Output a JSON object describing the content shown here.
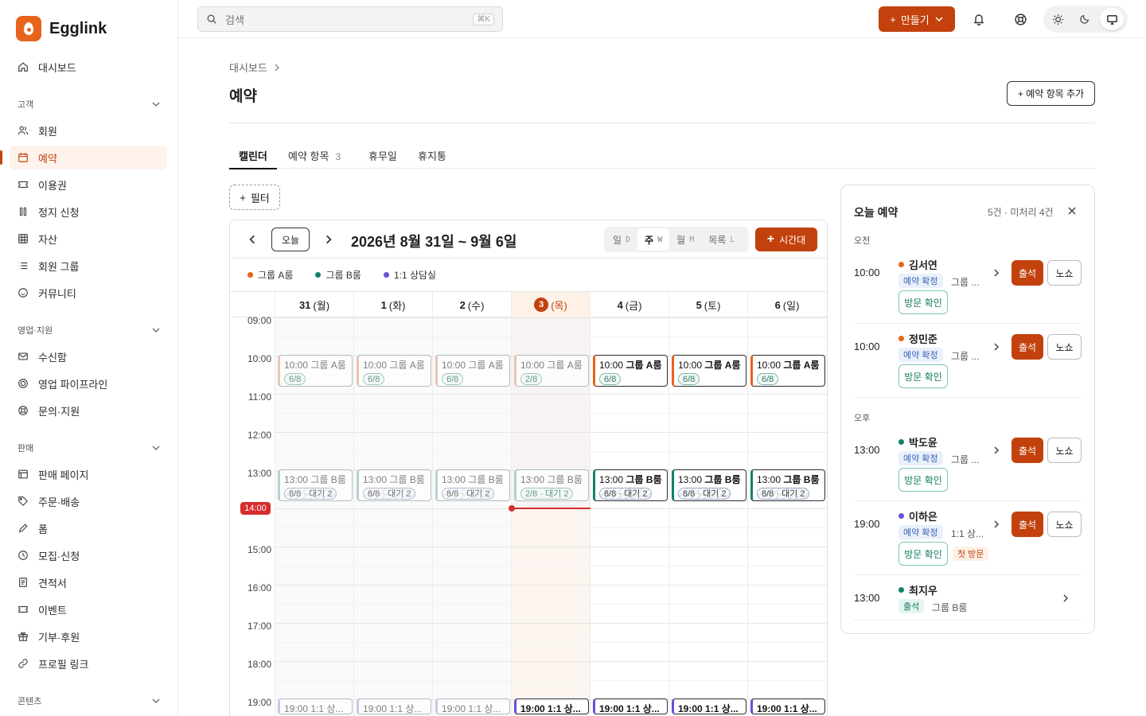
{
  "brand": {
    "name": "Egglink",
    "accent": "#c2410c"
  },
  "sidebar": {
    "top_item": {
      "label": "대시보드",
      "icon": "home-icon"
    },
    "sections": [
      {
        "title": "고객",
        "items": [
          {
            "label": "회원",
            "icon": "users-icon"
          },
          {
            "label": "예약",
            "icon": "calendar-icon",
            "active": true
          },
          {
            "label": "이용권",
            "icon": "ticket-icon"
          },
          {
            "label": "정지 신청",
            "icon": "pause-icon"
          },
          {
            "label": "자산",
            "icon": "grid-icon"
          },
          {
            "label": "회원 그룹",
            "icon": "list-icon"
          },
          {
            "label": "커뮤니티",
            "icon": "smile-icon"
          }
        ]
      },
      {
        "title": "영업·지원",
        "items": [
          {
            "label": "수신함",
            "icon": "mail-icon"
          },
          {
            "label": "영업 파이프라인",
            "icon": "target-icon"
          },
          {
            "label": "문의·지원",
            "icon": "lifebuoy-icon"
          }
        ]
      },
      {
        "title": "판매",
        "items": [
          {
            "label": "판매 페이지",
            "icon": "page-icon"
          },
          {
            "label": "주문·배송",
            "icon": "tag-icon"
          },
          {
            "label": "폼",
            "icon": "pen-icon"
          },
          {
            "label": "모집·신청",
            "icon": "clock-icon"
          },
          {
            "label": "견적서",
            "icon": "document-icon"
          },
          {
            "label": "이벤트",
            "icon": "ticket-icon"
          },
          {
            "label": "기부·후원",
            "icon": "gift-icon"
          },
          {
            "label": "프로필 링크",
            "icon": "link-icon"
          }
        ]
      },
      {
        "title": "콘텐츠",
        "items": []
      }
    ]
  },
  "topbar": {
    "search_placeholder": "검색",
    "search_shortcut": "⌘K",
    "create_label": "만들기"
  },
  "page": {
    "breadcrumb": "대시보드",
    "title": "예약",
    "add_button": "+ 예약 항목 추가",
    "tabs": [
      {
        "label": "캘린더",
        "active": true
      },
      {
        "label": "예약 항목",
        "count": "3"
      },
      {
        "label": "휴무일"
      },
      {
        "label": "휴지통"
      }
    ],
    "filter_label": "필터"
  },
  "calendar": {
    "today_label": "오늘",
    "range": "2026년 8월 31일 ~ 9월 6일",
    "views": [
      {
        "label": "일",
        "key": "D"
      },
      {
        "label": "주",
        "key": "W",
        "active": true
      },
      {
        "label": "월",
        "key": "M"
      },
      {
        "label": "목록",
        "key": "L"
      }
    ],
    "timeblock_label": "시간대",
    "legend": [
      {
        "label": "그룹 A룸",
        "color": "#e8631c"
      },
      {
        "label": "그룹 B룸",
        "color": "#12806b"
      },
      {
        "label": "1:1 상담실",
        "color": "#6a4fd8"
      }
    ],
    "days": [
      {
        "num": "31",
        "dow": "(월)"
      },
      {
        "num": "1",
        "dow": "(화)"
      },
      {
        "num": "2",
        "dow": "(수)"
      },
      {
        "num": "3",
        "dow": "(목)",
        "today": true
      },
      {
        "num": "4",
        "dow": "(금)"
      },
      {
        "num": "5",
        "dow": "(토)"
      },
      {
        "num": "6",
        "dow": "(일)"
      }
    ],
    "hours": [
      "09:00",
      "10:00",
      "11:00",
      "12:00",
      "13:00",
      "14:00",
      "15:00",
      "16:00",
      "17:00",
      "18:00",
      "19:00"
    ],
    "now_label": "14:00",
    "events": {
      "a": [
        {
          "time": "10:00",
          "room": "그룹 A룸",
          "cap": "6/8"
        },
        {
          "time": "10:00",
          "room": "그룹 A룸",
          "cap": "6/8"
        },
        {
          "time": "10:00",
          "room": "그룹 A룸",
          "cap": "6/8"
        },
        {
          "time": "10:00",
          "room": "그룹 A룸",
          "cap": "2/8"
        },
        {
          "time": "10:00",
          "room": "그룹 A룸",
          "cap": "6/8"
        },
        {
          "time": "10:00",
          "room": "그룹 A룸",
          "cap": "6/8"
        },
        {
          "time": "10:00",
          "room": "그룹 A룸",
          "cap": "6/8"
        }
      ],
      "b": [
        {
          "time": "13:00",
          "room": "그룹 B룸",
          "cap": "8/8 · 대기 2",
          "full": true
        },
        {
          "time": "13:00",
          "room": "그룹 B룸",
          "cap": "8/8 · 대기 2",
          "full": true
        },
        {
          "time": "13:00",
          "room": "그룹 B룸",
          "cap": "8/8 · 대기 2",
          "full": true
        },
        {
          "time": "13:00",
          "room": "그룹 B룸",
          "cap": "2/8 · 대기 2"
        },
        {
          "time": "13:00",
          "room": "그룹 B룸",
          "cap": "8/8 · 대기 2",
          "full": true
        },
        {
          "time": "13:00",
          "room": "그룹 B룸",
          "cap": "8/8 · 대기 2",
          "full": true
        },
        {
          "time": "13:00",
          "room": "그룹 B룸",
          "cap": "8/8 · 대기 2",
          "full": true
        }
      ],
      "c": [
        {
          "label": "19:00 1:1 상..."
        },
        {
          "label": "19:00 1:1 상..."
        },
        {
          "label": "19:00 1:1 상..."
        },
        {
          "label": "19:00 1:1 상..."
        },
        {
          "label": "19:00 1:1 상..."
        },
        {
          "label": "19:00 1:1 상..."
        },
        {
          "label": "19:00 1:1 상..."
        }
      ]
    }
  },
  "today_panel": {
    "title": "오늘 예약",
    "summary": "5건 · 미처리 4건",
    "am_label": "오전",
    "pm_label": "오후",
    "reservations": [
      {
        "time": "10:00",
        "name": "김서연",
        "color": "#e8631c",
        "status": "예약 확정",
        "room": "그룹 ...",
        "visit": "방문 확인",
        "attend": "출석",
        "noshow": "노쇼"
      },
      {
        "time": "10:00",
        "name": "정민준",
        "color": "#e8631c",
        "status": "예약 확정",
        "room": "그룹 ...",
        "visit": "방문 확인",
        "attend": "출석",
        "noshow": "노쇼"
      },
      {
        "time": "13:00",
        "name": "박도윤",
        "color": "#12806b",
        "status": "예약 확정",
        "room": "그룹 ...",
        "visit": "방문 확인",
        "attend": "출석",
        "noshow": "노쇼"
      },
      {
        "time": "19:00",
        "name": "이하은",
        "color": "#6a4fd8",
        "status": "예약 확정",
        "room": "1:1 상...",
        "visit": "방문 확인",
        "first": "첫 방문",
        "attend": "출석",
        "noshow": "노쇼"
      },
      {
        "time": "13:00",
        "name": "최지우",
        "color": "#12806b",
        "status": "출석",
        "room": "그룹 B룸"
      }
    ]
  }
}
